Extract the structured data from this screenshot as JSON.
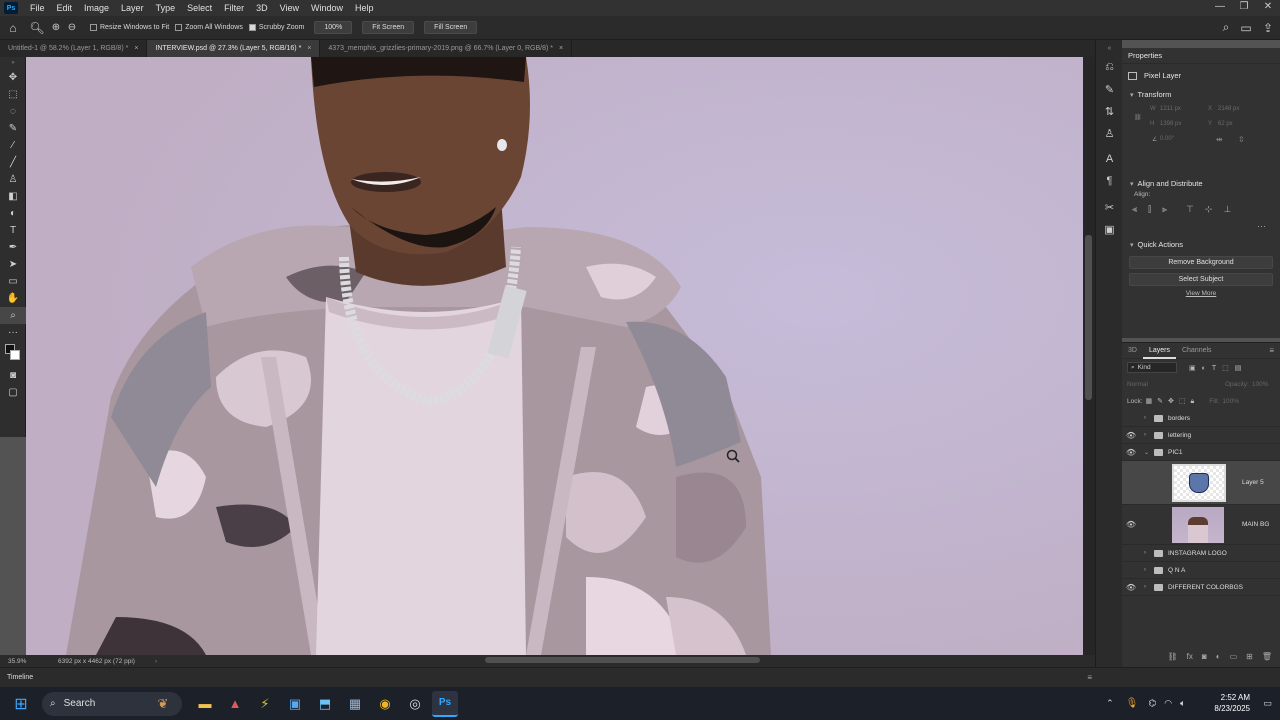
{
  "menu": [
    "File",
    "Edit",
    "Image",
    "Layer",
    "Type",
    "Select",
    "Filter",
    "3D",
    "View",
    "Window",
    "Help"
  ],
  "options": {
    "resize_windows": "Resize Windows to Fit",
    "zoom_all": "Zoom All Windows",
    "scrubby_zoom": "Scrubby Zoom",
    "zoom_100": "100%",
    "fit_screen": "Fit Screen",
    "fill_screen": "Fill Screen"
  },
  "tabs": [
    {
      "label": "Untitled-1 @ 58.2% (Layer 1, RGB/8) *",
      "active": false
    },
    {
      "label": "INTERVIEW.psd @ 27.3% (Layer 5, RGB/16) *",
      "active": true
    },
    {
      "label": "4373_memphis_grizzlies-primary-2019.png @ 66.7% (Layer 0, RGB/8) *",
      "active": false
    }
  ],
  "status": {
    "zoom": "35.9%",
    "doc_size": "6392 px x 4462 px (72 ppi)"
  },
  "properties": {
    "title": "Properties",
    "layer_type": "Pixel Layer",
    "transform": "Transform",
    "w": "W",
    "w_val": "1211 px",
    "h": "H",
    "h_val": "1398 px",
    "x": "X",
    "x_val": "2148 px",
    "y": "Y",
    "y_val": "62 px",
    "angle": "0.00°",
    "align": "Align and Distribute",
    "align_label": "Align:",
    "quick_actions": "Quick Actions",
    "remove_bg": "Remove Background",
    "select_subject": "Select Subject",
    "view_more": "View More"
  },
  "layers_panel": {
    "tabs": [
      "3D",
      "Layers",
      "Channels"
    ],
    "kind": "Kind",
    "blend": "Normal",
    "opacity_label": "Opacity:",
    "opacity": "100%",
    "lock_label": "Lock:",
    "fill_label": "Fill:",
    "fill": "100%",
    "items": [
      {
        "name": "borders",
        "type": "group",
        "visible": false,
        "expanded": false
      },
      {
        "name": "lettering",
        "type": "group",
        "visible": true,
        "expanded": false
      },
      {
        "name": "PIC1",
        "type": "group",
        "visible": true,
        "expanded": true
      },
      {
        "name": "Layer 5",
        "type": "pixel",
        "visible": false,
        "selected": true
      },
      {
        "name": "MAIN BG",
        "type": "pixel",
        "visible": true
      },
      {
        "name": "INSTAGRAM LOGO",
        "type": "group",
        "visible": false,
        "expanded": false
      },
      {
        "name": "Q N A",
        "type": "group",
        "visible": false,
        "expanded": false
      },
      {
        "name": "DIFFERENT COLORBGS",
        "type": "group",
        "visible": true,
        "expanded": false
      }
    ]
  },
  "timeline": "Timeline",
  "taskbar": {
    "search": "Search",
    "time": "2:52 AM",
    "date": "8/23/2025"
  },
  "colors": {
    "accent": "#31a8ff",
    "canvas_bg": "#c4b4c8"
  }
}
